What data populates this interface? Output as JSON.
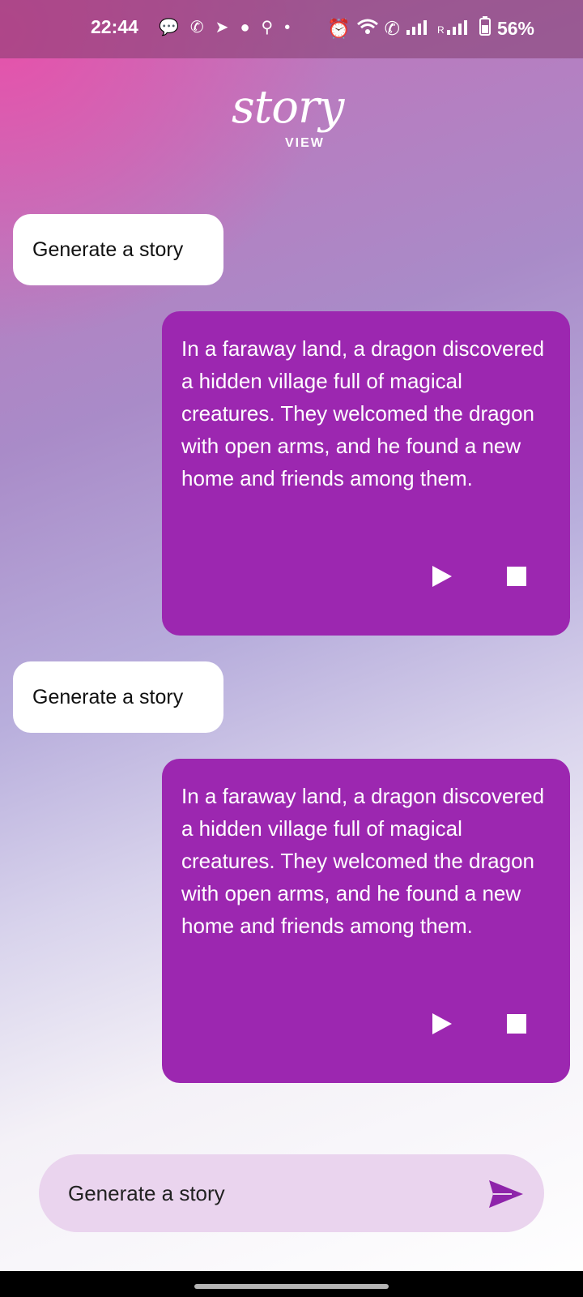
{
  "status_bar": {
    "time": "22:44",
    "battery": "56%",
    "icons": [
      "chat-icon",
      "missed-call-icon",
      "telegram-icon",
      "messages-icon",
      "location-icon",
      "dot-icon",
      "alarm-icon",
      "wifi-icon",
      "volte-icon",
      "signal-icon",
      "signal-roaming-icon",
      "battery-icon"
    ]
  },
  "header": {
    "logo_word": "story",
    "logo_sub": "VIEW"
  },
  "messages": [
    {
      "role": "user",
      "text": "Generate a story"
    },
    {
      "role": "bot",
      "text": "In a faraway land, a dragon discovered a hidden village full of magical creatures. They welcomed the dragon with open arms, and he found a new home and friends among them."
    },
    {
      "role": "user",
      "text": "Generate a story"
    },
    {
      "role": "bot",
      "text": "In a faraway land, a dragon discovered a hidden village full of magical creatures. They welcomed the dragon with open arms, and he found a new home and friends among them."
    }
  ],
  "composer": {
    "value": "Generate a story"
  },
  "colors": {
    "bot_bubble": "#9c27b0",
    "composer_bg": "#ead4ee",
    "send_icon": "#8e24aa"
  }
}
